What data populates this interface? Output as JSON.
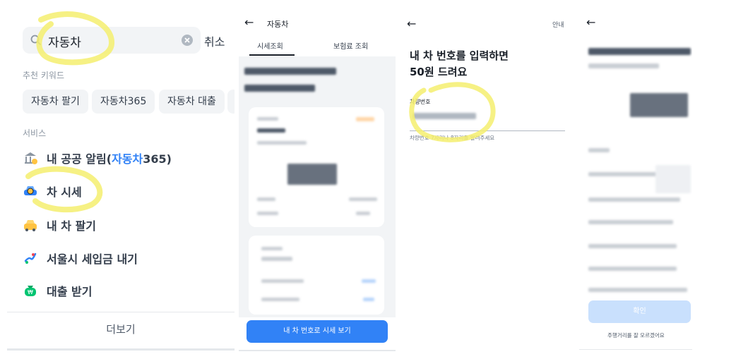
{
  "search": {
    "query": "자동차",
    "cancel_label": "취소",
    "recommended_label": "추천 키워드",
    "keywords": [
      "자동차 팔기",
      "자동차365",
      "자동차 대출"
    ],
    "services_label": "서비스",
    "services": [
      {
        "prefix": "내 공공 알림(",
        "highlight": "자동차",
        "suffix": "365)",
        "icon": "bank-bell-icon"
      },
      {
        "prefix": "차 시세",
        "highlight": "",
        "suffix": "",
        "icon": "car-search-icon"
      },
      {
        "prefix": "내 차 팔기",
        "highlight": "",
        "suffix": "",
        "icon": "car-sell-icon"
      },
      {
        "prefix": "서울시 세입금 내기",
        "highlight": "",
        "suffix": "",
        "icon": "seoul-tax-icon"
      },
      {
        "prefix": "대출 받기",
        "highlight": "",
        "suffix": "",
        "icon": "money-bag-icon"
      }
    ],
    "more_label": "더보기"
  },
  "car_price": {
    "title": "자동차",
    "tabs": [
      "시세조회",
      "보험료 조회"
    ],
    "button_label": "내 차 번호로 시세 보기"
  },
  "plate_input": {
    "guide_label": "안내",
    "heading_line1": "내 차 번호를 입력하면",
    "heading_line2": "50원 드려요",
    "field_label": "차량번호",
    "hint": "차량번호 7자리나 8자리를 알려주세요"
  },
  "confirm": {
    "button_label": "확인",
    "mileage_link": "주행거리를 잘 모르겠어요"
  },
  "colors": {
    "accent": "#3182f6",
    "highlighter": "#f5ef6e",
    "text": "#191f28",
    "muted": "#8b95a1"
  }
}
